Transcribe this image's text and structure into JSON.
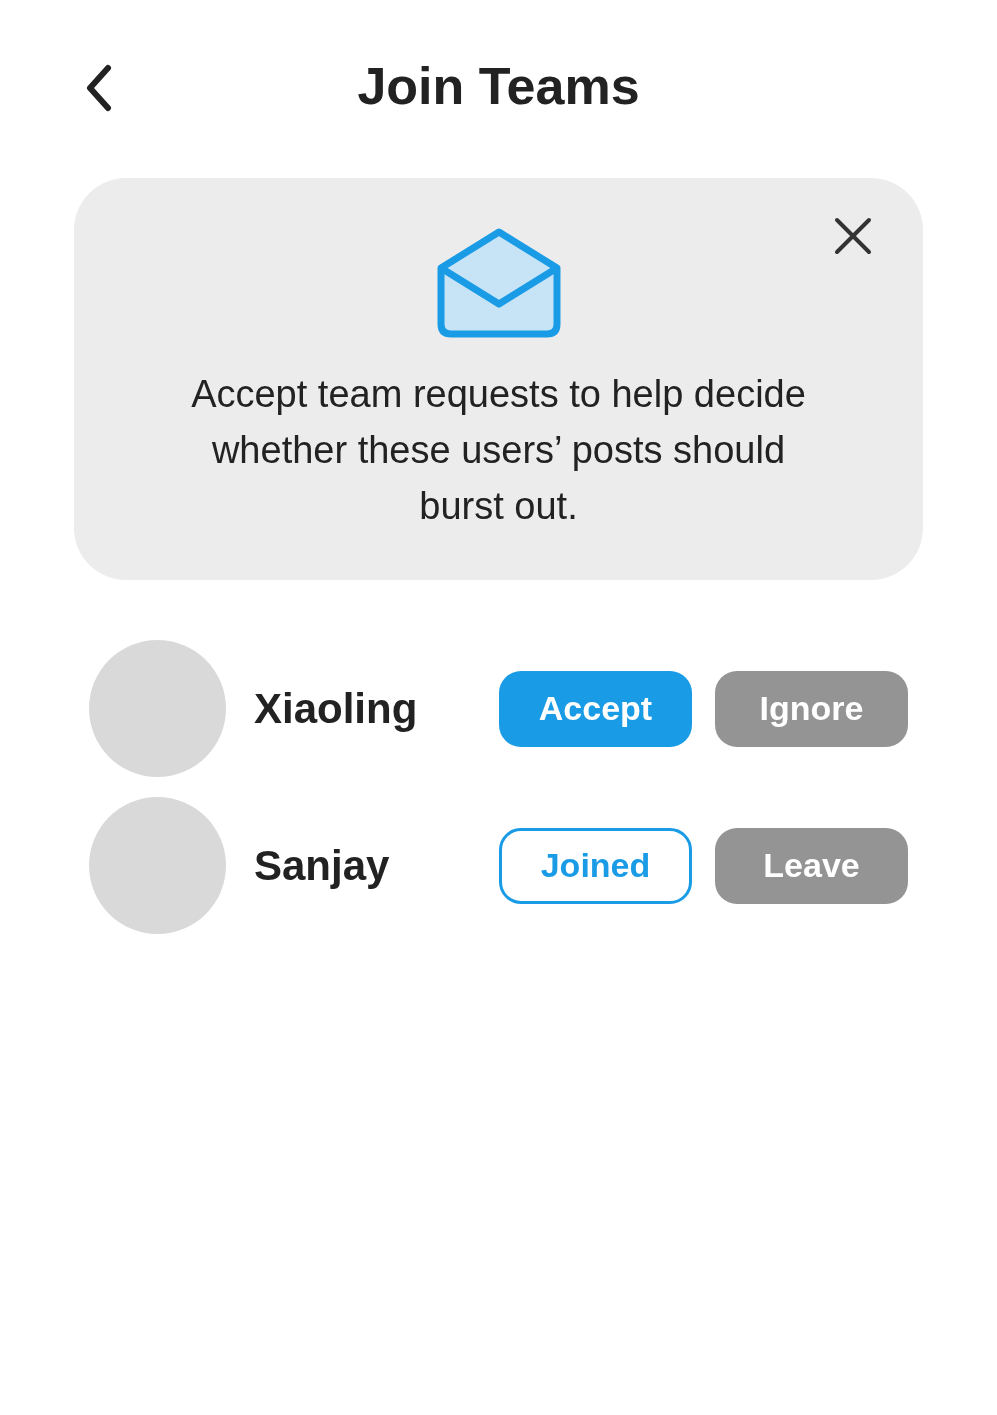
{
  "header": {
    "title": "Join Teams"
  },
  "notice": {
    "message": "Accept team requests to help decide whether these users’ posts should burst out."
  },
  "requests": [
    {
      "name": "Xiaoling",
      "buttons": [
        {
          "label": "Accept",
          "kind": "primary"
        },
        {
          "label": "Ignore",
          "kind": "secondary"
        }
      ]
    },
    {
      "name": "Sanjay",
      "buttons": [
        {
          "label": "Joined",
          "kind": "outline"
        },
        {
          "label": "Leave",
          "kind": "secondary"
        }
      ]
    }
  ]
}
